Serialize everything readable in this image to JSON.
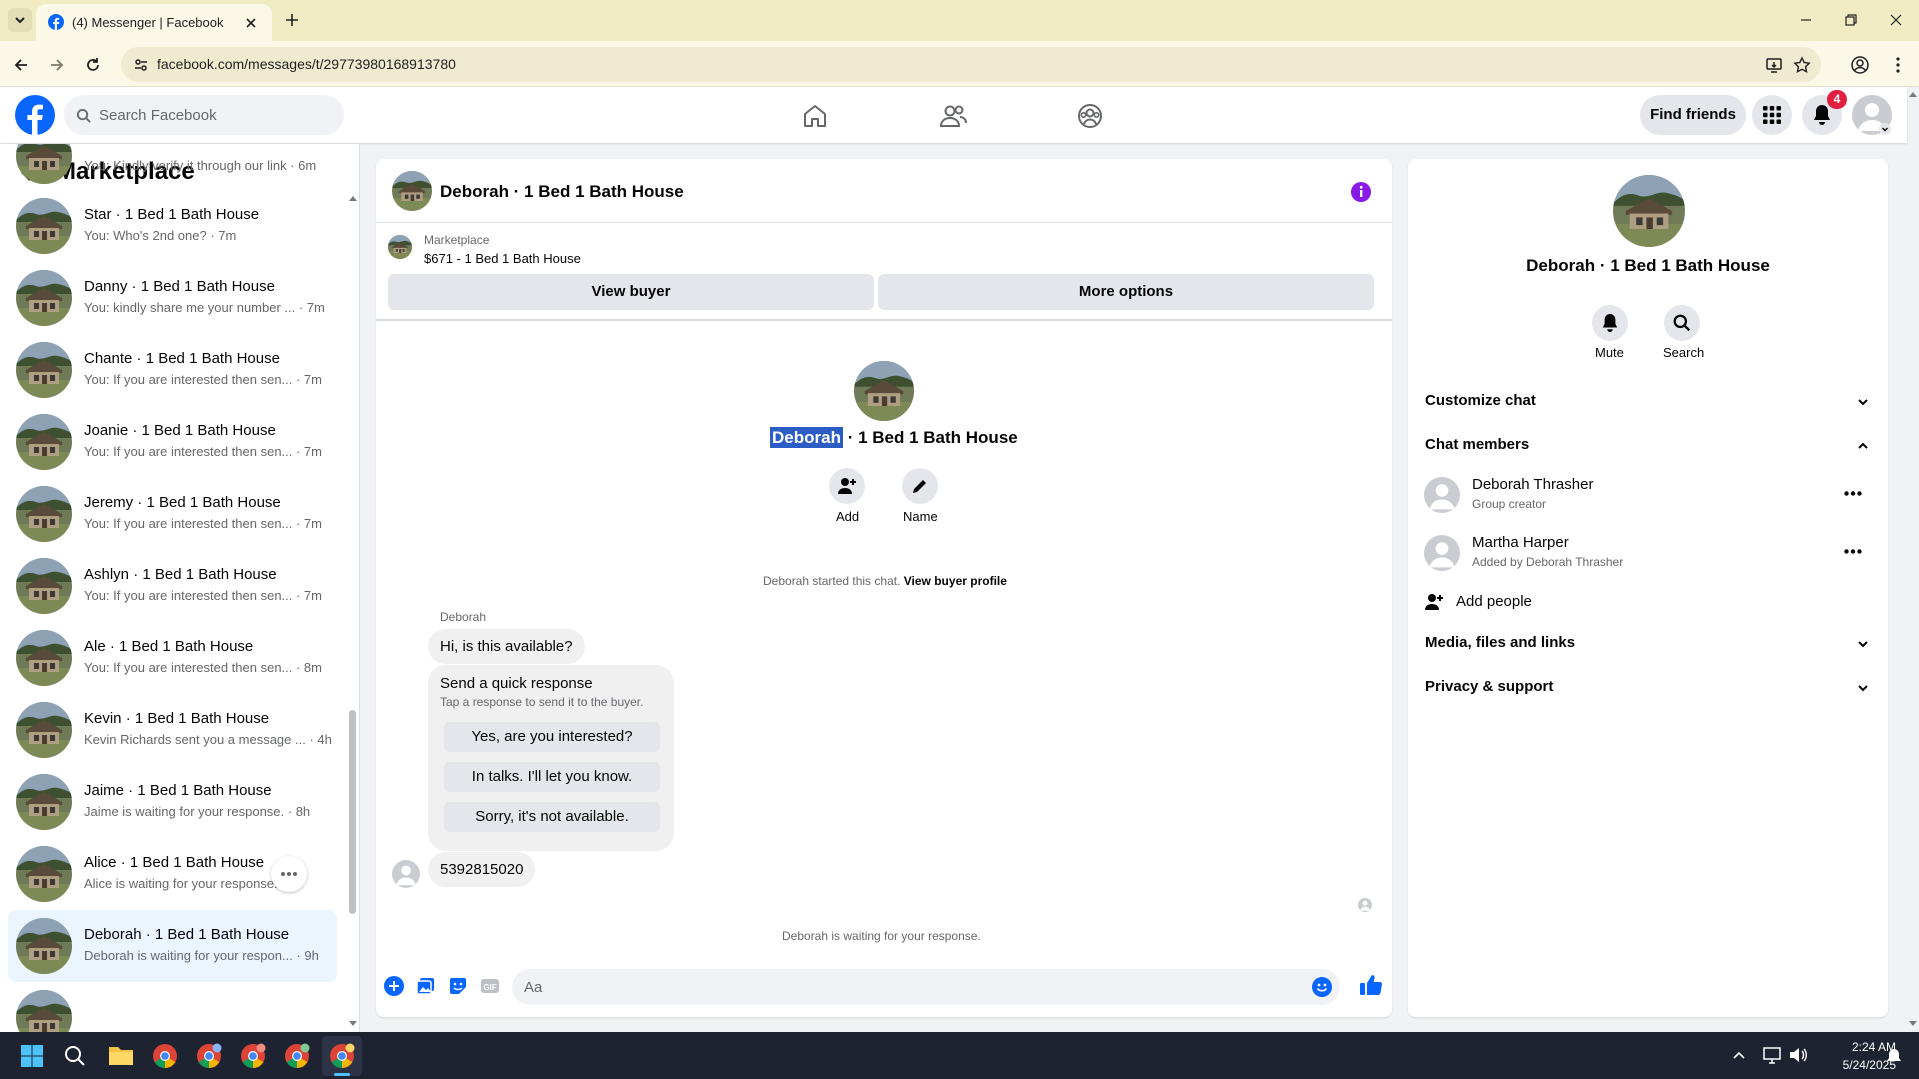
{
  "browser": {
    "tab_title": "(4) Messenger | Facebook",
    "url": "facebook.com/messages/t/29773980168913780"
  },
  "header": {
    "search_placeholder": "Search Facebook",
    "find_friends": "Find friends",
    "notification_count": "4",
    "brand_color": "#0866ff"
  },
  "sidebar": {
    "title": "Marketplace",
    "items": [
      {
        "name": "",
        "preview": "You: Kindly verify it through our link · 6m"
      },
      {
        "name": "Star · 1 Bed 1 Bath House",
        "preview": "You: Who's 2nd one? · 7m"
      },
      {
        "name": "Danny · 1 Bed 1 Bath House",
        "preview": "You: kindly share me your number ... · 7m"
      },
      {
        "name": "Chante · 1 Bed 1 Bath House",
        "preview": "You: If you are interested then sen... · 7m"
      },
      {
        "name": "Joanie · 1 Bed 1 Bath House",
        "preview": "You: If you are interested then sen... · 7m"
      },
      {
        "name": "Jeremy · 1 Bed 1 Bath House",
        "preview": "You: If you are interested then sen... · 7m"
      },
      {
        "name": "Ashlyn · 1 Bed 1 Bath House",
        "preview": "You: If you are interested then sen... · 7m"
      },
      {
        "name": "Ale · 1 Bed 1 Bath House",
        "preview": "You: If you are interested then sen... · 8m"
      },
      {
        "name": "Kevin · 1 Bed 1 Bath House",
        "preview": "Kevin Richards sent you a message ... · 4h"
      },
      {
        "name": "Jaime · 1 Bed 1 Bath House",
        "preview": "Jaime is waiting for your response. · 8h"
      },
      {
        "name": "Alice · 1 Bed 1 Bath House",
        "preview": "Alice is waiting for your response."
      },
      {
        "name": "Deborah · 1 Bed 1 Bath House",
        "preview": "Deborah is waiting for your respon... · 9h"
      }
    ]
  },
  "chat": {
    "title": "Deborah · 1 Bed 1 Bath House",
    "listing_source": "Marketplace",
    "listing": "$671 - 1 Bed 1 Bath House",
    "view_buyer": "View buyer",
    "more_options": "More options",
    "center_name_highlight": "Deborah",
    "center_name_rest": " · 1 Bed 1 Bath House",
    "add_label": "Add",
    "name_label": "Name",
    "started_text": "Deborah started this chat.",
    "view_buyer_profile": "View buyer profile",
    "sender": "Deborah",
    "msg1": "Hi, is this available?",
    "quick_title": "Send a quick response",
    "quick_sub": "Tap a response to send it to the buyer.",
    "quick_options": [
      "Yes, are you interested?",
      "In talks. I'll let you know.",
      "Sorry, it's not available."
    ],
    "msg2": "5392815020",
    "waiting": "Deborah is waiting for your response.",
    "composer_placeholder": "Aa"
  },
  "details": {
    "name": "Deborah · 1 Bed 1 Bath House",
    "mute": "Mute",
    "search": "Search",
    "customize": "Customize chat",
    "members": "Chat members",
    "member1_name": "Deborah Thrasher",
    "member1_sub": "Group creator",
    "member2_name": "Martha Harper",
    "member2_sub": "Added by Deborah Thrasher",
    "add_people": "Add people",
    "media": "Media, files and links",
    "privacy": "Privacy & support"
  },
  "taskbar": {
    "time": "2:24 AM",
    "date": "5/24/2025"
  }
}
